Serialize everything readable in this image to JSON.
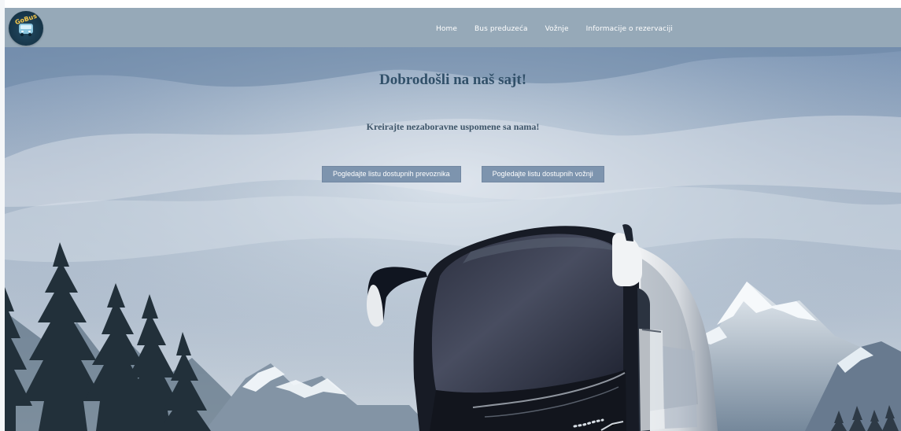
{
  "header": {
    "logo_text": "GoBus",
    "nav": [
      "Home",
      "Bus preduzeća",
      "Vožnje",
      "Informacije o rezervaciji"
    ]
  },
  "hero": {
    "title": "Dobrodošli na naš sajt!",
    "subtitle": "Kreirajte nezaboravne uspomene sa nama!",
    "buttons": [
      "Pogledajte listu dostupnih prevoznika",
      "Pogledajte listu dostupnih vožnji"
    ]
  },
  "colors": {
    "navbar": "#96a9b8",
    "button": "#7d94ae",
    "title": "#315069"
  }
}
